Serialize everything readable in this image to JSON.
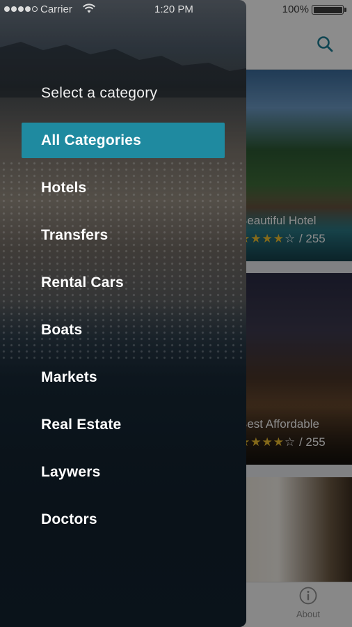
{
  "status_bar": {
    "carrier": "Carrier",
    "time": "1:20 PM",
    "battery": "100%",
    "signal_bars": 4
  },
  "drawer": {
    "heading": "Select a category",
    "selected_index": 0,
    "categories": [
      {
        "label": "All Categories"
      },
      {
        "label": "Hotels"
      },
      {
        "label": "Transfers"
      },
      {
        "label": "Rental Cars"
      },
      {
        "label": "Boats"
      },
      {
        "label": "Markets"
      },
      {
        "label": "Real Estate"
      },
      {
        "label": "Laywers"
      },
      {
        "label": "Doctors"
      }
    ]
  },
  "main": {
    "cards": [
      {
        "title": "Beautiful Hotel",
        "stars": "★★★★",
        "empty_stars": "☆",
        "reviews": "/ 255"
      },
      {
        "title": "Best Affordable",
        "stars": "★★★★",
        "empty_stars": "☆",
        "reviews": "/ 255"
      },
      {
        "title": "",
        "stars": "",
        "empty_stars": "",
        "reviews": ""
      }
    ],
    "tab_bar": {
      "about_label": "About"
    }
  },
  "colors": {
    "accent": "#1f8aa0",
    "star": "#f2c230",
    "search_icon": "#1d7f95"
  },
  "icons": {
    "search": "search-icon",
    "about": "info-circle-icon",
    "wifi": "wifi-icon",
    "battery": "battery-icon"
  }
}
